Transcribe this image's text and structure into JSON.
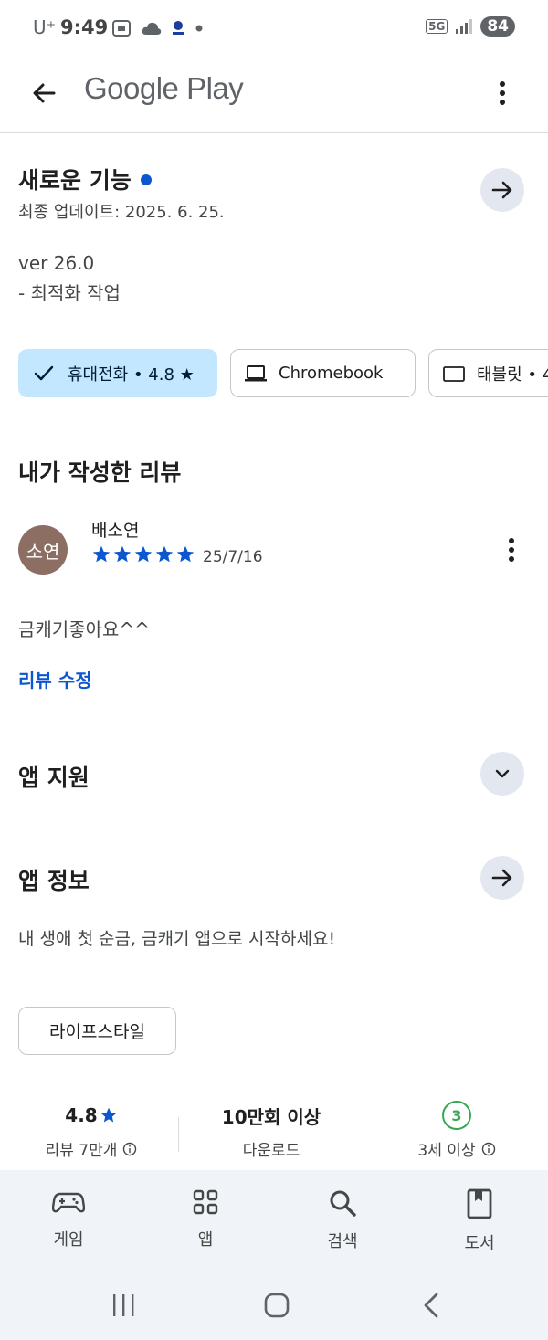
{
  "status_bar": {
    "carrier": "U⁺",
    "time": "9:49",
    "network": "5G",
    "battery": "84"
  },
  "app_bar": {
    "title": "Google Play"
  },
  "whats_new": {
    "title": "새로운 기능",
    "last_updated": "최종 업데이트: 2025. 6. 25.",
    "version": "ver 26.0",
    "note": "- 최적화 작업"
  },
  "device_chips": [
    {
      "label": "휴대전화 • 4.8 ★",
      "selected": true
    },
    {
      "label": "Chromebook",
      "selected": false
    },
    {
      "label": "태블릿 • 4",
      "selected": false
    }
  ],
  "my_review": {
    "heading": "내가 작성한 리뷰",
    "avatar_text": "소연",
    "reviewer_name": "배소연",
    "rating_stars": 5,
    "date": "25/7/16",
    "text": "금캐기좋아요^^",
    "edit_label": "리뷰 수정"
  },
  "app_support": {
    "heading": "앱 지원"
  },
  "app_info": {
    "heading": "앱 정보",
    "description": "내 생애 첫 순금, 금캐기 앱으로 시작하세요!",
    "category": "라이프스타일"
  },
  "stats": {
    "rating": "4.8",
    "rating_label": "리뷰 7만개",
    "downloads": "10만회 이상",
    "downloads_label": "다운로드",
    "age_badge": "3",
    "age_label": "3세 이상"
  },
  "bottom_nav": {
    "items": [
      {
        "label": "게임",
        "icon": "gamepad-icon"
      },
      {
        "label": "앱",
        "icon": "apps-grid-icon"
      },
      {
        "label": "검색",
        "icon": "search-icon"
      },
      {
        "label": "도서",
        "icon": "book-icon"
      }
    ]
  },
  "colors": {
    "accent": "#0b57d0",
    "chip_selected_bg": "#c2e7ff",
    "circle_button_bg": "#e3e8f0",
    "nav_bg": "#f0f4f9",
    "avatar_bg": "#8d6e63",
    "age_green": "#34a853"
  }
}
